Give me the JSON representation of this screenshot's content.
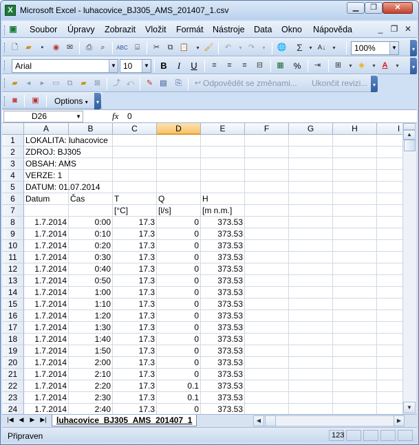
{
  "window": {
    "title": "Microsoft Excel - luhacovice_BJ305_AMS_201407_1.csv",
    "app_icon": "X"
  },
  "menu": [
    "Soubor",
    "Úpravy",
    "Zobrazit",
    "Vložit",
    "Formát",
    "Nástroje",
    "Data",
    "Okno",
    "Nápověda"
  ],
  "toolbar": {
    "zoom": "100%",
    "font": "Arial",
    "size": "10",
    "bold": "B",
    "italic": "I",
    "underline": "U",
    "percent": "%"
  },
  "review": {
    "reply": "Odpovědět se změnami...",
    "end": "Ukončit revizi..."
  },
  "options_label": "Options",
  "formula": {
    "cell_ref": "D26",
    "fx": "fx",
    "value": "0"
  },
  "columns": [
    "A",
    "B",
    "C",
    "D",
    "E",
    "F",
    "G",
    "H",
    "I"
  ],
  "selected_column": "D",
  "row_numbers": [
    "1",
    "2",
    "3",
    "4",
    "5",
    "6",
    "7",
    "8",
    "9",
    "10",
    "11",
    "12",
    "13",
    "14",
    "15",
    "16",
    "17",
    "18",
    "19",
    "20",
    "21",
    "22",
    "23",
    "24"
  ],
  "header_rows": {
    "r1": "LOKALITA: luhacovice",
    "r2": "ZDROJ: BJ305",
    "r3": "OBSAH: AMS",
    "r4": "VERZE: 1",
    "r5": "DATUM: 01.07.2014",
    "r6": [
      "Datum",
      "Čas",
      "T",
      "Q",
      "H"
    ],
    "r7": [
      "",
      "",
      "[°C]",
      "[l/s]",
      "[m n.m.]"
    ]
  },
  "data_rows": [
    [
      "1.7.2014",
      "0:00",
      "17.3",
      "0",
      "373.53"
    ],
    [
      "1.7.2014",
      "0:10",
      "17.3",
      "0",
      "373.53"
    ],
    [
      "1.7.2014",
      "0:20",
      "17.3",
      "0",
      "373.53"
    ],
    [
      "1.7.2014",
      "0:30",
      "17.3",
      "0",
      "373.53"
    ],
    [
      "1.7.2014",
      "0:40",
      "17.3",
      "0",
      "373.53"
    ],
    [
      "1.7.2014",
      "0:50",
      "17.3",
      "0",
      "373.53"
    ],
    [
      "1.7.2014",
      "1:00",
      "17.3",
      "0",
      "373.53"
    ],
    [
      "1.7.2014",
      "1:10",
      "17.3",
      "0",
      "373.53"
    ],
    [
      "1.7.2014",
      "1:20",
      "17.3",
      "0",
      "373.53"
    ],
    [
      "1.7.2014",
      "1:30",
      "17.3",
      "0",
      "373.53"
    ],
    [
      "1.7.2014",
      "1:40",
      "17.3",
      "0",
      "373.53"
    ],
    [
      "1.7.2014",
      "1:50",
      "17.3",
      "0",
      "373.53"
    ],
    [
      "1.7.2014",
      "2:00",
      "17.3",
      "0",
      "373.53"
    ],
    [
      "1.7.2014",
      "2:10",
      "17.3",
      "0",
      "373.53"
    ],
    [
      "1.7.2014",
      "2:20",
      "17.3",
      "0.1",
      "373.53"
    ],
    [
      "1.7.2014",
      "2:30",
      "17.3",
      "0.1",
      "373.53"
    ],
    [
      "1.7.2014",
      "2:40",
      "17.3",
      "0",
      "373.53"
    ]
  ],
  "sheet_tab": "luhacovice_BJ305_AMS_201407_1",
  "status": {
    "text": "Připraven",
    "num": "123"
  }
}
